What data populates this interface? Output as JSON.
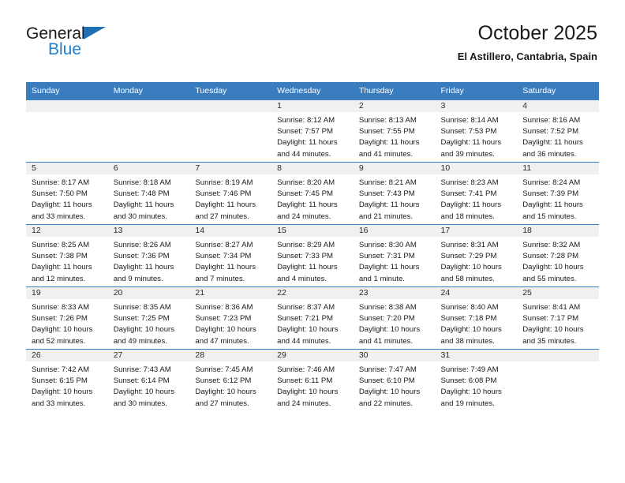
{
  "brand": {
    "name_top": "General",
    "name_bottom": "Blue",
    "triangle_color": "#1f6fb5",
    "blue_text_color": "#1f7fd0"
  },
  "header": {
    "title": "October 2025",
    "location": "El Astillero, Cantabria, Spain"
  },
  "theme": {
    "header_blue": "#3a7dbf",
    "daynum_band": "#f0f0f0",
    "text": "#1a1a1a"
  },
  "weekday_headers": [
    "Sunday",
    "Monday",
    "Tuesday",
    "Wednesday",
    "Thursday",
    "Friday",
    "Saturday"
  ],
  "labels": {
    "sunrise_prefix": "Sunrise:",
    "sunset_prefix": "Sunset:",
    "daylight_prefix": "Daylight:"
  },
  "weeks": [
    [
      {
        "day": "",
        "blank": true
      },
      {
        "day": "",
        "blank": true
      },
      {
        "day": "",
        "blank": true
      },
      {
        "day": "1",
        "sunrise": "Sunrise: 8:12 AM",
        "sunset": "Sunset: 7:57 PM",
        "daylight_l1": "Daylight: 11 hours",
        "daylight_l2": "and 44 minutes."
      },
      {
        "day": "2",
        "sunrise": "Sunrise: 8:13 AM",
        "sunset": "Sunset: 7:55 PM",
        "daylight_l1": "Daylight: 11 hours",
        "daylight_l2": "and 41 minutes."
      },
      {
        "day": "3",
        "sunrise": "Sunrise: 8:14 AM",
        "sunset": "Sunset: 7:53 PM",
        "daylight_l1": "Daylight: 11 hours",
        "daylight_l2": "and 39 minutes."
      },
      {
        "day": "4",
        "sunrise": "Sunrise: 8:16 AM",
        "sunset": "Sunset: 7:52 PM",
        "daylight_l1": "Daylight: 11 hours",
        "daylight_l2": "and 36 minutes."
      }
    ],
    [
      {
        "day": "5",
        "sunrise": "Sunrise: 8:17 AM",
        "sunset": "Sunset: 7:50 PM",
        "daylight_l1": "Daylight: 11 hours",
        "daylight_l2": "and 33 minutes."
      },
      {
        "day": "6",
        "sunrise": "Sunrise: 8:18 AM",
        "sunset": "Sunset: 7:48 PM",
        "daylight_l1": "Daylight: 11 hours",
        "daylight_l2": "and 30 minutes."
      },
      {
        "day": "7",
        "sunrise": "Sunrise: 8:19 AM",
        "sunset": "Sunset: 7:46 PM",
        "daylight_l1": "Daylight: 11 hours",
        "daylight_l2": "and 27 minutes."
      },
      {
        "day": "8",
        "sunrise": "Sunrise: 8:20 AM",
        "sunset": "Sunset: 7:45 PM",
        "daylight_l1": "Daylight: 11 hours",
        "daylight_l2": "and 24 minutes."
      },
      {
        "day": "9",
        "sunrise": "Sunrise: 8:21 AM",
        "sunset": "Sunset: 7:43 PM",
        "daylight_l1": "Daylight: 11 hours",
        "daylight_l2": "and 21 minutes."
      },
      {
        "day": "10",
        "sunrise": "Sunrise: 8:23 AM",
        "sunset": "Sunset: 7:41 PM",
        "daylight_l1": "Daylight: 11 hours",
        "daylight_l2": "and 18 minutes."
      },
      {
        "day": "11",
        "sunrise": "Sunrise: 8:24 AM",
        "sunset": "Sunset: 7:39 PM",
        "daylight_l1": "Daylight: 11 hours",
        "daylight_l2": "and 15 minutes."
      }
    ],
    [
      {
        "day": "12",
        "sunrise": "Sunrise: 8:25 AM",
        "sunset": "Sunset: 7:38 PM",
        "daylight_l1": "Daylight: 11 hours",
        "daylight_l2": "and 12 minutes."
      },
      {
        "day": "13",
        "sunrise": "Sunrise: 8:26 AM",
        "sunset": "Sunset: 7:36 PM",
        "daylight_l1": "Daylight: 11 hours",
        "daylight_l2": "and 9 minutes."
      },
      {
        "day": "14",
        "sunrise": "Sunrise: 8:27 AM",
        "sunset": "Sunset: 7:34 PM",
        "daylight_l1": "Daylight: 11 hours",
        "daylight_l2": "and 7 minutes."
      },
      {
        "day": "15",
        "sunrise": "Sunrise: 8:29 AM",
        "sunset": "Sunset: 7:33 PM",
        "daylight_l1": "Daylight: 11 hours",
        "daylight_l2": "and 4 minutes."
      },
      {
        "day": "16",
        "sunrise": "Sunrise: 8:30 AM",
        "sunset": "Sunset: 7:31 PM",
        "daylight_l1": "Daylight: 11 hours",
        "daylight_l2": "and 1 minute."
      },
      {
        "day": "17",
        "sunrise": "Sunrise: 8:31 AM",
        "sunset": "Sunset: 7:29 PM",
        "daylight_l1": "Daylight: 10 hours",
        "daylight_l2": "and 58 minutes."
      },
      {
        "day": "18",
        "sunrise": "Sunrise: 8:32 AM",
        "sunset": "Sunset: 7:28 PM",
        "daylight_l1": "Daylight: 10 hours",
        "daylight_l2": "and 55 minutes."
      }
    ],
    [
      {
        "day": "19",
        "sunrise": "Sunrise: 8:33 AM",
        "sunset": "Sunset: 7:26 PM",
        "daylight_l1": "Daylight: 10 hours",
        "daylight_l2": "and 52 minutes."
      },
      {
        "day": "20",
        "sunrise": "Sunrise: 8:35 AM",
        "sunset": "Sunset: 7:25 PM",
        "daylight_l1": "Daylight: 10 hours",
        "daylight_l2": "and 49 minutes."
      },
      {
        "day": "21",
        "sunrise": "Sunrise: 8:36 AM",
        "sunset": "Sunset: 7:23 PM",
        "daylight_l1": "Daylight: 10 hours",
        "daylight_l2": "and 47 minutes."
      },
      {
        "day": "22",
        "sunrise": "Sunrise: 8:37 AM",
        "sunset": "Sunset: 7:21 PM",
        "daylight_l1": "Daylight: 10 hours",
        "daylight_l2": "and 44 minutes."
      },
      {
        "day": "23",
        "sunrise": "Sunrise: 8:38 AM",
        "sunset": "Sunset: 7:20 PM",
        "daylight_l1": "Daylight: 10 hours",
        "daylight_l2": "and 41 minutes."
      },
      {
        "day": "24",
        "sunrise": "Sunrise: 8:40 AM",
        "sunset": "Sunset: 7:18 PM",
        "daylight_l1": "Daylight: 10 hours",
        "daylight_l2": "and 38 minutes."
      },
      {
        "day": "25",
        "sunrise": "Sunrise: 8:41 AM",
        "sunset": "Sunset: 7:17 PM",
        "daylight_l1": "Daylight: 10 hours",
        "daylight_l2": "and 35 minutes."
      }
    ],
    [
      {
        "day": "26",
        "sunrise": "Sunrise: 7:42 AM",
        "sunset": "Sunset: 6:15 PM",
        "daylight_l1": "Daylight: 10 hours",
        "daylight_l2": "and 33 minutes."
      },
      {
        "day": "27",
        "sunrise": "Sunrise: 7:43 AM",
        "sunset": "Sunset: 6:14 PM",
        "daylight_l1": "Daylight: 10 hours",
        "daylight_l2": "and 30 minutes."
      },
      {
        "day": "28",
        "sunrise": "Sunrise: 7:45 AM",
        "sunset": "Sunset: 6:12 PM",
        "daylight_l1": "Daylight: 10 hours",
        "daylight_l2": "and 27 minutes."
      },
      {
        "day": "29",
        "sunrise": "Sunrise: 7:46 AM",
        "sunset": "Sunset: 6:11 PM",
        "daylight_l1": "Daylight: 10 hours",
        "daylight_l2": "and 24 minutes."
      },
      {
        "day": "30",
        "sunrise": "Sunrise: 7:47 AM",
        "sunset": "Sunset: 6:10 PM",
        "daylight_l1": "Daylight: 10 hours",
        "daylight_l2": "and 22 minutes."
      },
      {
        "day": "31",
        "sunrise": "Sunrise: 7:49 AM",
        "sunset": "Sunset: 6:08 PM",
        "daylight_l1": "Daylight: 10 hours",
        "daylight_l2": "and 19 minutes."
      },
      {
        "day": "",
        "blank": true
      }
    ]
  ]
}
